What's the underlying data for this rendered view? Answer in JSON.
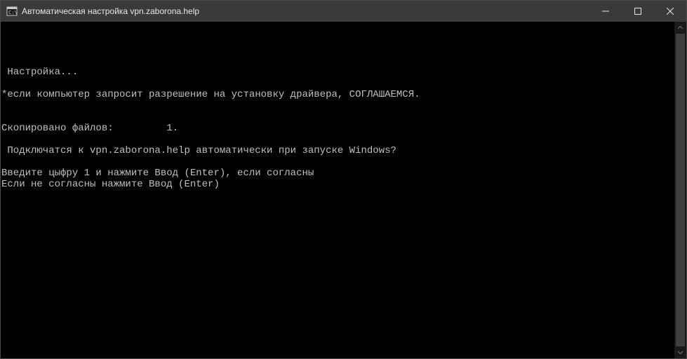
{
  "window": {
    "title": "Автоматическая настройка vpn.zaborona.help"
  },
  "console": {
    "lines": [
      "",
      "",
      " Настройка...",
      "",
      "*если компьютер запросит разрешение на установку драйвера, СОГЛАШАЕМСЯ.",
      "",
      "",
      "Скопировано файлов:         1.",
      "",
      " Подключатся к vpn.zaborona.help автоматически при запуске Windows?",
      "",
      "Введите цыфру 1 и нажмите Ввод (Enter), если согласны",
      "Если не согласны нажмите Ввод (Enter)"
    ]
  }
}
